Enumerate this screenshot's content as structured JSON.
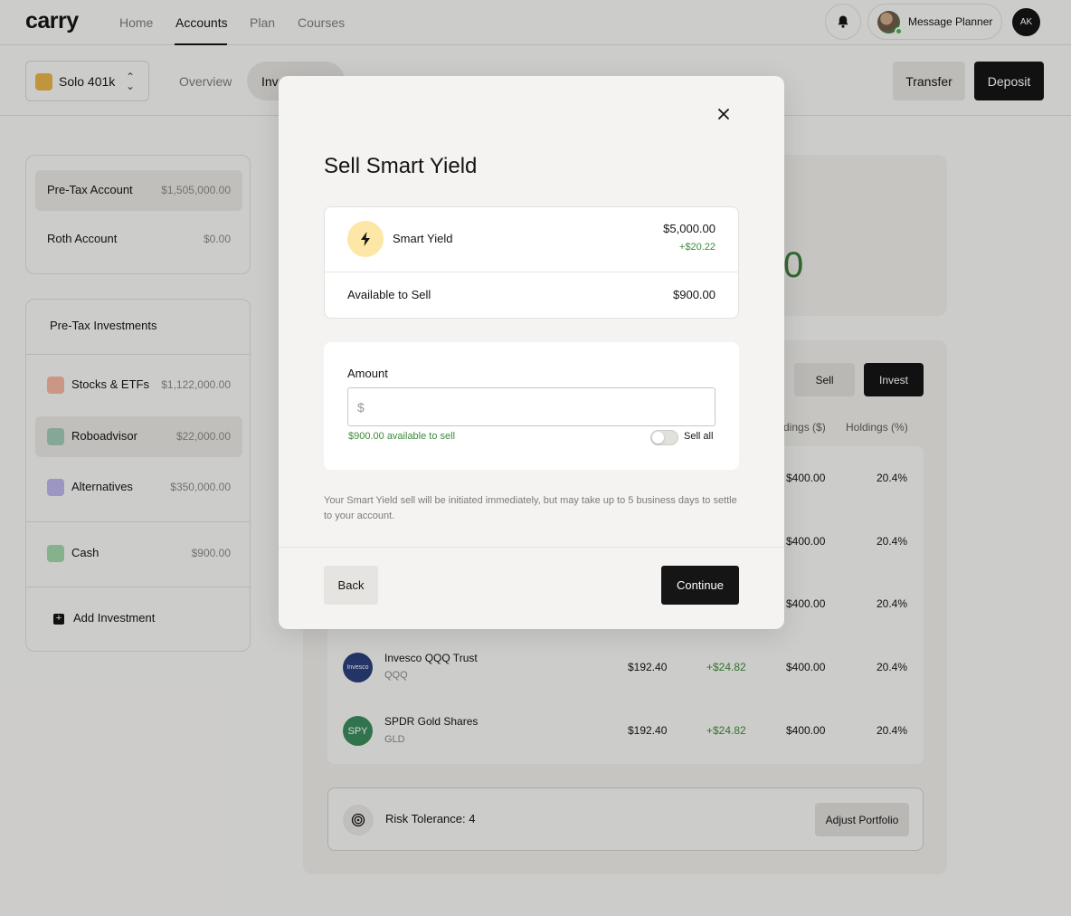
{
  "topnav": {
    "logo": "carry",
    "links": [
      "Home",
      "Accounts",
      "Plan",
      "Courses"
    ],
    "active_link": "Accounts",
    "message_planner": "Message Planner",
    "user_initials": "AK"
  },
  "subheader": {
    "account_selector": "Solo 401k",
    "tabs": [
      "Overview",
      "Inv"
    ],
    "transfer_label": "Transfer",
    "deposit_label": "Deposit"
  },
  "accounts": [
    {
      "name": "Pre-Tax Account",
      "value": "$1,505,000.00"
    },
    {
      "name": "Roth Account",
      "value": "$0.00"
    }
  ],
  "investments": {
    "heading": "Pre-Tax Investments",
    "items": [
      {
        "name": "Stocks & ETFs",
        "value": "$1,122,000.00"
      },
      {
        "name": "Roboadvisor",
        "value": "$22,000.00"
      },
      {
        "name": "Alternatives",
        "value": "$350,000.00"
      },
      {
        "name": "Cash",
        "value": "$900.00"
      }
    ],
    "add_label": "Add Investment"
  },
  "main": {
    "balance_fragment": "0",
    "sell_label": "Sell",
    "invest_label": "Invest",
    "columns": [
      "dings ($)",
      "Holdings (%)"
    ],
    "partial_rows": [
      {
        "holdings": "$400.00",
        "pct": "20.4%"
      },
      {
        "holdings": "$400.00",
        "pct": "20.4%"
      },
      {
        "holdings": "$400.00",
        "pct": "20.4%"
      }
    ],
    "rows": [
      {
        "logo": "Invesco",
        "name": "Invesco QQQ Trust",
        "symbol": "QQQ",
        "price": "$192.40",
        "change": "+$24.82",
        "holdings": "$400.00",
        "pct": "20.4%"
      },
      {
        "logo": "SPY",
        "name": "SPDR Gold Shares",
        "symbol": "GLD",
        "price": "$192.40",
        "change": "+$24.82",
        "holdings": "$400.00",
        "pct": "20.4%"
      }
    ],
    "risk_label": "Risk Tolerance: 4",
    "adjust_label": "Adjust Portfolio"
  },
  "modal": {
    "title": "Sell Smart Yield",
    "fund_name": "Smart Yield",
    "fund_value": "$5,000.00",
    "fund_gain": "+$20.22",
    "available_label": "Available to Sell",
    "available_value": "$900.00",
    "amount_label": "Amount",
    "amount_placeholder": "$",
    "available_hint": "$900.00 available to sell",
    "sell_all_label": "Sell all",
    "disclaimer": "Your Smart Yield sell will be initiated immediately, but may take up to 5 business days to settle to your account.",
    "back_label": "Back",
    "continue_label": "Continue"
  },
  "colors": {
    "accent_green": "#3d8a39",
    "primary_dark": "#151515",
    "fund_icon_bg": "#fde7a6"
  }
}
